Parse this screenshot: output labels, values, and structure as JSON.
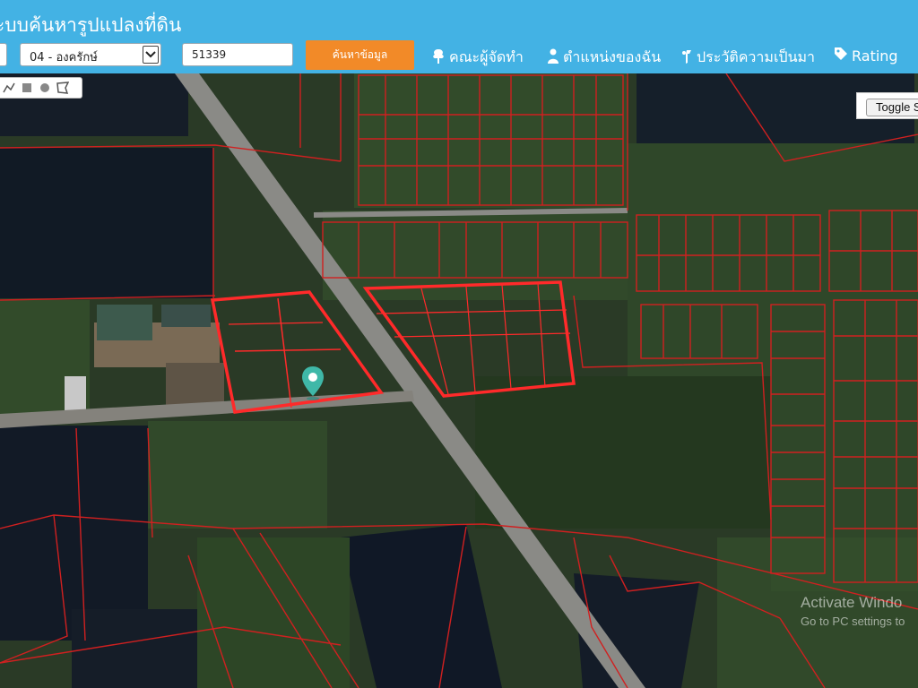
{
  "header": {
    "title": "ะบบค้นหารูปแปลงที่ดิน",
    "district_select": "04 - องครักษ์",
    "parcel_number": "51339",
    "search_button": "ค้นหาข้อมูล",
    "nav": [
      {
        "icon": "tree-icon",
        "label": "คณะผู้จัดทำ"
      },
      {
        "icon": "person-icon",
        "label": "ตำแหน่งของฉัน"
      },
      {
        "icon": "history-icon",
        "label": "ประวัติความเป็นมา"
      },
      {
        "icon": "tag-icon",
        "label": "Rating"
      }
    ]
  },
  "map": {
    "toggle_button": "Toggle S",
    "draw_tools": [
      "polyline-icon",
      "rectangle-icon",
      "circle-icon",
      "polygon-icon"
    ],
    "marker_icon": "map-marker-icon",
    "parcel_line_color": "#e02020",
    "selected_parcel_color": "#ff2a2a",
    "accent_colors": {
      "header": "#43b2e4",
      "search_button": "#f28a28",
      "marker": "#3fb8a8"
    }
  },
  "watermark": {
    "line1": "Activate Windo",
    "line2": "Go to PC settings to"
  }
}
